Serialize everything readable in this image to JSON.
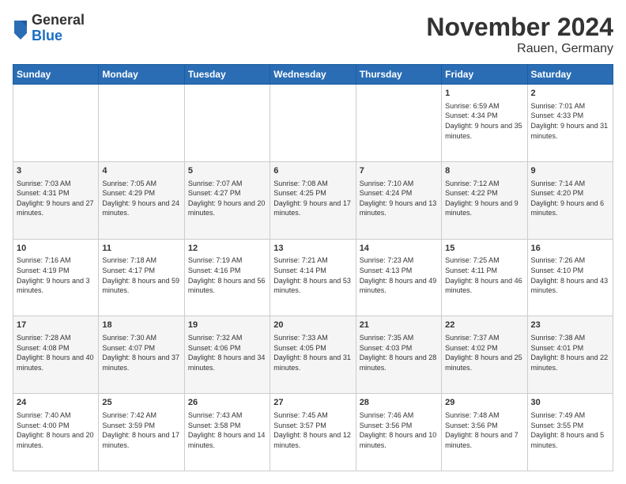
{
  "logo": {
    "general": "General",
    "blue": "Blue"
  },
  "title": "November 2024",
  "subtitle": "Rauen, Germany",
  "weekdays": [
    "Sunday",
    "Monday",
    "Tuesday",
    "Wednesday",
    "Thursday",
    "Friday",
    "Saturday"
  ],
  "weeks": [
    [
      {
        "day": "",
        "info": ""
      },
      {
        "day": "",
        "info": ""
      },
      {
        "day": "",
        "info": ""
      },
      {
        "day": "",
        "info": ""
      },
      {
        "day": "",
        "info": ""
      },
      {
        "day": "1",
        "info": "Sunrise: 6:59 AM\nSunset: 4:34 PM\nDaylight: 9 hours\nand 35 minutes."
      },
      {
        "day": "2",
        "info": "Sunrise: 7:01 AM\nSunset: 4:33 PM\nDaylight: 9 hours\nand 31 minutes."
      }
    ],
    [
      {
        "day": "3",
        "info": "Sunrise: 7:03 AM\nSunset: 4:31 PM\nDaylight: 9 hours\nand 27 minutes."
      },
      {
        "day": "4",
        "info": "Sunrise: 7:05 AM\nSunset: 4:29 PM\nDaylight: 9 hours\nand 24 minutes."
      },
      {
        "day": "5",
        "info": "Sunrise: 7:07 AM\nSunset: 4:27 PM\nDaylight: 9 hours\nand 20 minutes."
      },
      {
        "day": "6",
        "info": "Sunrise: 7:08 AM\nSunset: 4:25 PM\nDaylight: 9 hours\nand 17 minutes."
      },
      {
        "day": "7",
        "info": "Sunrise: 7:10 AM\nSunset: 4:24 PM\nDaylight: 9 hours\nand 13 minutes."
      },
      {
        "day": "8",
        "info": "Sunrise: 7:12 AM\nSunset: 4:22 PM\nDaylight: 9 hours\nand 9 minutes."
      },
      {
        "day": "9",
        "info": "Sunrise: 7:14 AM\nSunset: 4:20 PM\nDaylight: 9 hours\nand 6 minutes."
      }
    ],
    [
      {
        "day": "10",
        "info": "Sunrise: 7:16 AM\nSunset: 4:19 PM\nDaylight: 9 hours\nand 3 minutes."
      },
      {
        "day": "11",
        "info": "Sunrise: 7:18 AM\nSunset: 4:17 PM\nDaylight: 8 hours\nand 59 minutes."
      },
      {
        "day": "12",
        "info": "Sunrise: 7:19 AM\nSunset: 4:16 PM\nDaylight: 8 hours\nand 56 minutes."
      },
      {
        "day": "13",
        "info": "Sunrise: 7:21 AM\nSunset: 4:14 PM\nDaylight: 8 hours\nand 53 minutes."
      },
      {
        "day": "14",
        "info": "Sunrise: 7:23 AM\nSunset: 4:13 PM\nDaylight: 8 hours\nand 49 minutes."
      },
      {
        "day": "15",
        "info": "Sunrise: 7:25 AM\nSunset: 4:11 PM\nDaylight: 8 hours\nand 46 minutes."
      },
      {
        "day": "16",
        "info": "Sunrise: 7:26 AM\nSunset: 4:10 PM\nDaylight: 8 hours\nand 43 minutes."
      }
    ],
    [
      {
        "day": "17",
        "info": "Sunrise: 7:28 AM\nSunset: 4:08 PM\nDaylight: 8 hours\nand 40 minutes."
      },
      {
        "day": "18",
        "info": "Sunrise: 7:30 AM\nSunset: 4:07 PM\nDaylight: 8 hours\nand 37 minutes."
      },
      {
        "day": "19",
        "info": "Sunrise: 7:32 AM\nSunset: 4:06 PM\nDaylight: 8 hours\nand 34 minutes."
      },
      {
        "day": "20",
        "info": "Sunrise: 7:33 AM\nSunset: 4:05 PM\nDaylight: 8 hours\nand 31 minutes."
      },
      {
        "day": "21",
        "info": "Sunrise: 7:35 AM\nSunset: 4:03 PM\nDaylight: 8 hours\nand 28 minutes."
      },
      {
        "day": "22",
        "info": "Sunrise: 7:37 AM\nSunset: 4:02 PM\nDaylight: 8 hours\nand 25 minutes."
      },
      {
        "day": "23",
        "info": "Sunrise: 7:38 AM\nSunset: 4:01 PM\nDaylight: 8 hours\nand 22 minutes."
      }
    ],
    [
      {
        "day": "24",
        "info": "Sunrise: 7:40 AM\nSunset: 4:00 PM\nDaylight: 8 hours\nand 20 minutes."
      },
      {
        "day": "25",
        "info": "Sunrise: 7:42 AM\nSunset: 3:59 PM\nDaylight: 8 hours\nand 17 minutes."
      },
      {
        "day": "26",
        "info": "Sunrise: 7:43 AM\nSunset: 3:58 PM\nDaylight: 8 hours\nand 14 minutes."
      },
      {
        "day": "27",
        "info": "Sunrise: 7:45 AM\nSunset: 3:57 PM\nDaylight: 8 hours\nand 12 minutes."
      },
      {
        "day": "28",
        "info": "Sunrise: 7:46 AM\nSunset: 3:56 PM\nDaylight: 8 hours\nand 10 minutes."
      },
      {
        "day": "29",
        "info": "Sunrise: 7:48 AM\nSunset: 3:56 PM\nDaylight: 8 hours\nand 7 minutes."
      },
      {
        "day": "30",
        "info": "Sunrise: 7:49 AM\nSunset: 3:55 PM\nDaylight: 8 hours\nand 5 minutes."
      }
    ]
  ]
}
